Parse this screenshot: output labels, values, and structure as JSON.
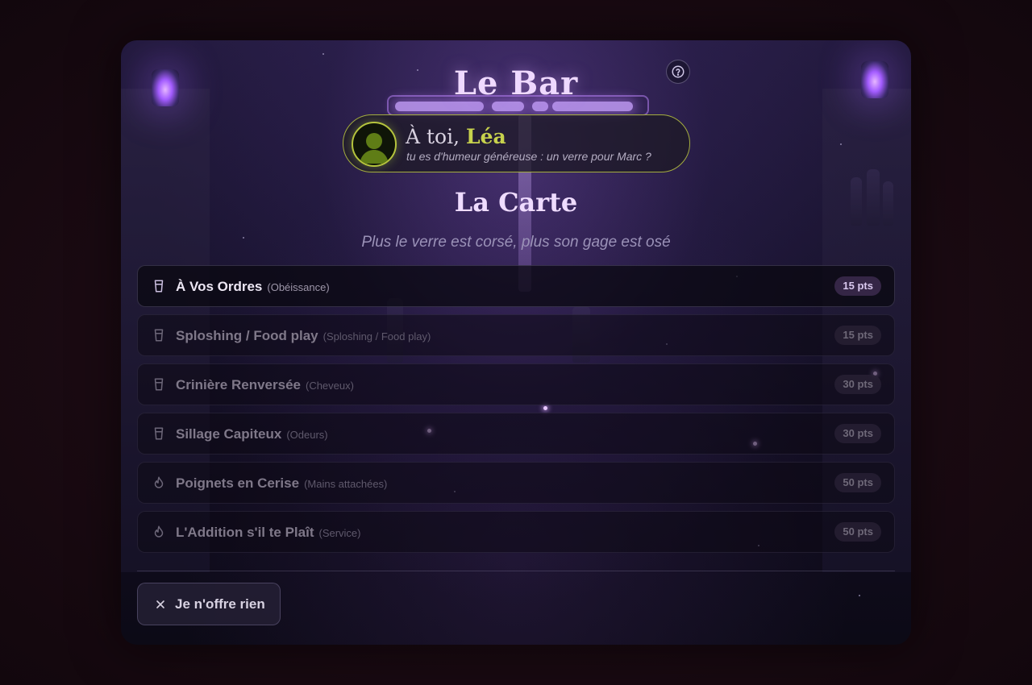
{
  "title": "Le Bar",
  "help_icon": "question-circle-icon",
  "turn": {
    "prefix": "À toi,",
    "player_name": "Léa",
    "subtitle": "tu es d'humeur généreuse : un verre pour Marc ?",
    "avatar_icon": "user-silhouette-icon"
  },
  "menu": {
    "title": "La Carte",
    "subtitle": "Plus le verre est corsé, plus son gage est osé",
    "items": [
      {
        "label": "À Vos Ordres",
        "alt": "(Obéissance)",
        "points": "15 pts",
        "icon": "glass-icon",
        "active": true
      },
      {
        "label": "Sploshing / Food play",
        "alt": "(Sploshing / Food play)",
        "points": "15 pts",
        "icon": "glass-icon",
        "active": false
      },
      {
        "label": "Crinière Renversée",
        "alt": "(Cheveux)",
        "points": "30 pts",
        "icon": "glass-icon",
        "active": false
      },
      {
        "label": "Sillage Capiteux",
        "alt": "(Odeurs)",
        "points": "30 pts",
        "icon": "glass-icon",
        "active": false
      },
      {
        "label": "Poignets en Cerise",
        "alt": "(Mains attachées)",
        "points": "50 pts",
        "icon": "flame-icon",
        "active": false
      },
      {
        "label": "L'Addition s'il te Plaît",
        "alt": "(Service)",
        "points": "50 pts",
        "icon": "flame-icon",
        "active": false
      }
    ]
  },
  "decline_button": {
    "label": "Je n'offre rien",
    "icon": "close-icon"
  },
  "colors": {
    "accent": "#c7d14d",
    "neon": "#c9a2ff"
  }
}
